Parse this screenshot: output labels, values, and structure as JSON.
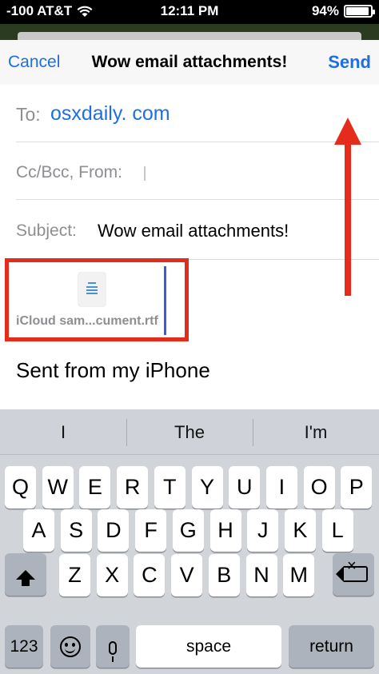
{
  "status_bar": {
    "carrier": "-100 AT&T",
    "time": "12:11 PM",
    "battery": "94%",
    "battery_level": 0.94
  },
  "compose": {
    "cancel_label": "Cancel",
    "title": "Wow email attachments!",
    "send_label": "Send",
    "to_label": "To:",
    "to_value": "osxdaily. com",
    "cc_label": "Cc/Bcc, From:",
    "subject_label": "Subject:",
    "subject_value": "Wow email attachments!",
    "attachment_name": "iCloud sam...cument.rtf",
    "signature": "Sent from my iPhone"
  },
  "keyboard": {
    "suggestions": [
      "I",
      "The",
      "I'm"
    ],
    "row1": [
      "Q",
      "W",
      "E",
      "R",
      "T",
      "Y",
      "U",
      "I",
      "O",
      "P"
    ],
    "row2": [
      "A",
      "S",
      "D",
      "F",
      "G",
      "H",
      "J",
      "K",
      "L"
    ],
    "row3": [
      "Z",
      "X",
      "C",
      "V",
      "B",
      "N",
      "M"
    ],
    "numbers_label": "123",
    "space_label": "space",
    "return_label": "return"
  },
  "colors": {
    "link_blue": "#1f6fe0",
    "annotation_red": "#e52b1b"
  }
}
